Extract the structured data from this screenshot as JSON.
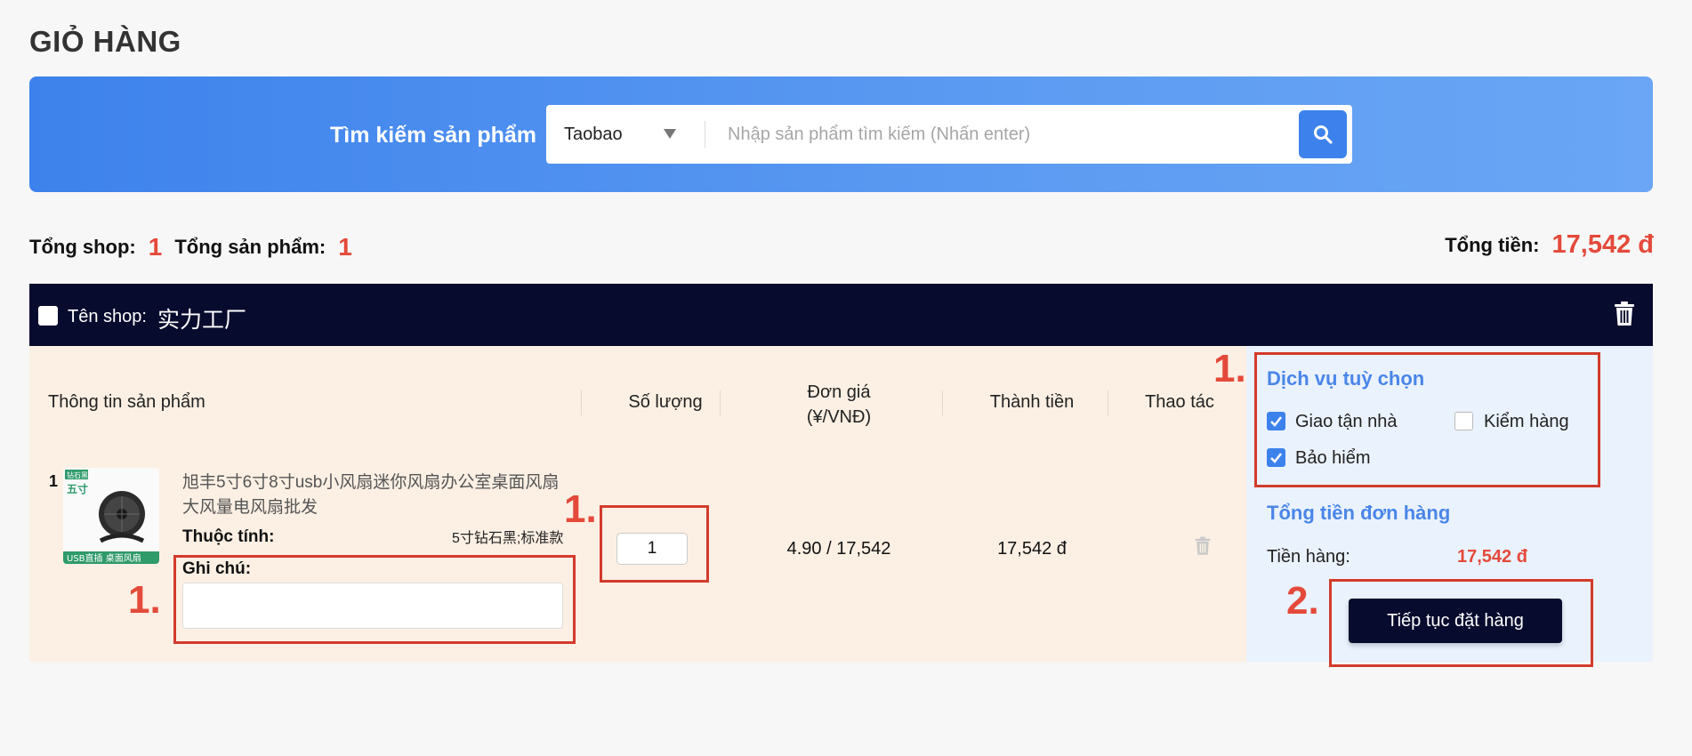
{
  "page": {
    "title": "GIỎ HÀNG"
  },
  "search": {
    "label": "Tìm kiếm sản phẩm",
    "platform": "Taobao",
    "placeholder": "Nhập sản phẩm tìm kiếm (Nhấn enter)",
    "value": ""
  },
  "summary": {
    "shop_count_label": "Tổng shop:",
    "shop_count": "1",
    "product_count_label": "Tổng sản phẩm:",
    "product_count": "1",
    "total_label": "Tổng tiền:",
    "total_value": "17,542 đ"
  },
  "shop": {
    "label": "Tên shop:",
    "name": "实力工厂"
  },
  "table": {
    "headers": {
      "product": "Thông tin sản phẩm",
      "quantity": "Số lượng",
      "unit_price_line1": "Đơn giá",
      "unit_price_line2": "(¥/VNĐ)",
      "total": "Thành tiền",
      "actions": "Thao tác"
    },
    "rows": [
      {
        "index": "1",
        "name": "旭丰5寸6寸8寸usb小风扇迷你风扇办公室桌面风扇大风量电风扇批发",
        "attr_label": "Thuộc tính:",
        "attr_value": "5寸钻石黑;标准款",
        "note_label": "Ghi chú:",
        "note_value": "",
        "quantity": "1",
        "unit_price": "4.90 / 17,542",
        "line_total": "17,542 đ",
        "thumb_badge_top": "钻石黑",
        "thumb_size": "五寸",
        "thumb_bottom": "USB直插  桌面风扇"
      }
    ]
  },
  "services": {
    "title": "Dịch vụ tuỳ chọn",
    "options": [
      {
        "label": "Giao tận nhà",
        "checked": true
      },
      {
        "label": "Kiểm hàng",
        "checked": false
      },
      {
        "label": "Bảo hiểm",
        "checked": true
      }
    ]
  },
  "order_total": {
    "title": "Tổng tiền đơn hàng",
    "goods_label": "Tiền hàng:",
    "goods_value": "17,542 đ",
    "continue_label": "Tiếp tục đặt hàng"
  },
  "annotations": {
    "note_step": "1.",
    "qty_step": "1.",
    "services_step": "1.",
    "continue_step": "2."
  },
  "colors": {
    "accent": "#3d82ec",
    "dark": "#070b2d",
    "price_red": "#e44a3a",
    "annotation_red": "#d33b2c",
    "row_bg": "#fcefe4",
    "panel_bg": "#eaf2fd"
  }
}
